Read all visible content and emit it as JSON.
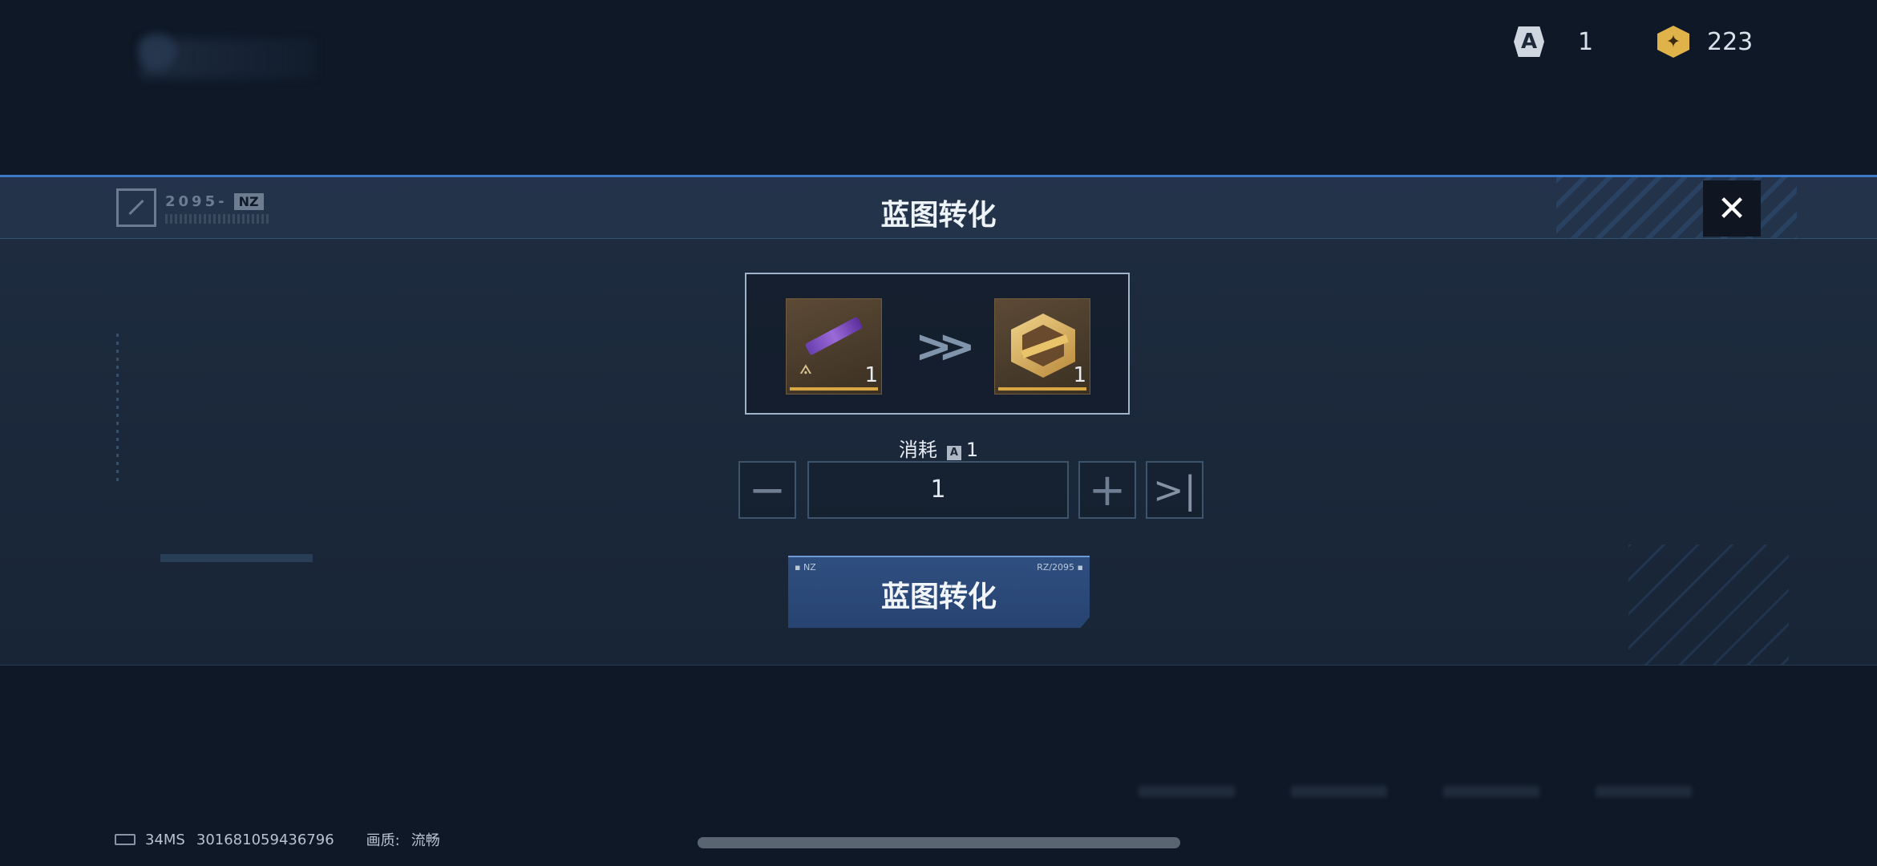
{
  "topbar": {
    "blueprint_icon": "A",
    "blueprint_count": "1",
    "coin_count": "223"
  },
  "modal": {
    "title": "蓝图转化",
    "header_code": "2095-",
    "header_tag": "NZ",
    "source_item_count": "1",
    "target_item_count": "1",
    "cost_label": "消耗",
    "cost_amount": "1",
    "quantity": "1",
    "action_label": "蓝图转化",
    "action_deco_left": "▪ NZ",
    "action_deco_right": "RZ/2095 ▪"
  },
  "status": {
    "ping": "34MS",
    "uid": "301681059436796",
    "quality_label": "画质:",
    "quality_value": "流畅"
  },
  "icons": {
    "close": "close-icon",
    "minus": "minus-icon",
    "plus": "plus-icon",
    "max": "max-icon",
    "arrow": "double-chevron-right-icon"
  }
}
